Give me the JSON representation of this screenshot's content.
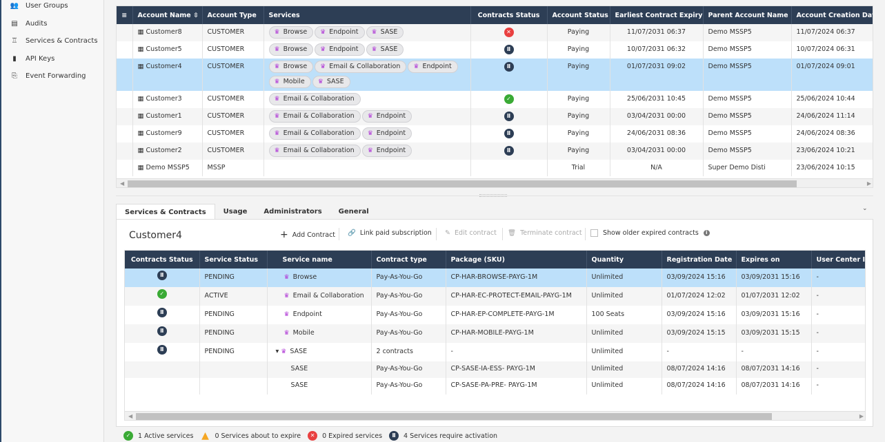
{
  "sidebar": {
    "items": [
      {
        "label": "User Groups",
        "icon": "users-icon",
        "glyph": "👥"
      },
      {
        "label": "Audits",
        "icon": "clipboard-icon",
        "glyph": "▤"
      },
      {
        "label": "Services & Contracts",
        "icon": "award-icon",
        "glyph": "♖"
      },
      {
        "label": "API Keys",
        "icon": "key-box-icon",
        "glyph": "▮"
      },
      {
        "label": "Event Forwarding",
        "icon": "forward-doc-icon",
        "glyph": "⎘"
      }
    ]
  },
  "accounts": {
    "columns": [
      "Account Name",
      "Account Type",
      "Services",
      "Contracts Status",
      "Account Status",
      "Earliest Contract Expiry",
      "Parent Account Name",
      "Account Creation Date"
    ],
    "rows": [
      {
        "name": "Customer8",
        "type": "CUSTOMER",
        "services": [
          "Browse",
          "Endpoint",
          "SASE"
        ],
        "contracts_status": "expired",
        "account_status": "Paying",
        "expiry": "11/07/2031 06:37",
        "parent": "Demo MSSP5",
        "created": "11/07/2024 06:37"
      },
      {
        "name": "Customer5",
        "type": "CUSTOMER",
        "services": [
          "Browse",
          "Endpoint",
          "SASE"
        ],
        "contracts_status": "pending",
        "account_status": "Paying",
        "expiry": "10/07/2031 06:32",
        "parent": "Demo MSSP5",
        "created": "10/07/2024 06:31"
      },
      {
        "name": "Customer4",
        "type": "CUSTOMER",
        "services": [
          "Browse",
          "Email & Collaboration",
          "Endpoint",
          "Mobile",
          "SASE"
        ],
        "contracts_status": "pending",
        "account_status": "Paying",
        "expiry": "01/07/2031 09:02",
        "parent": "Demo MSSP5",
        "created": "01/07/2024 09:01",
        "selected": true
      },
      {
        "name": "Customer3",
        "type": "CUSTOMER",
        "services": [
          "Email & Collaboration"
        ],
        "contracts_status": "active",
        "account_status": "Paying",
        "expiry": "25/06/2031 10:45",
        "parent": "Demo MSSP5",
        "created": "25/06/2024 10:44"
      },
      {
        "name": "Customer1",
        "type": "CUSTOMER",
        "services": [
          "Email & Collaboration",
          "Endpoint"
        ],
        "contracts_status": "pending",
        "account_status": "Paying",
        "expiry": "03/04/2031 00:00",
        "parent": "Demo MSSP5",
        "created": "24/06/2024 11:14"
      },
      {
        "name": "Customer9",
        "type": "CUSTOMER",
        "services": [
          "Email & Collaboration",
          "Endpoint"
        ],
        "contracts_status": "pending",
        "account_status": "Paying",
        "expiry": "24/06/2031 08:36",
        "parent": "Demo MSSP5",
        "created": "24/06/2024 08:36"
      },
      {
        "name": "Customer2",
        "type": "CUSTOMER",
        "services": [
          "Email & Collaboration",
          "Endpoint"
        ],
        "contracts_status": "pending",
        "account_status": "Paying",
        "expiry": "03/04/2031 00:00",
        "parent": "Demo MSSP5",
        "created": "23/06/2024 10:21"
      },
      {
        "name": "Demo MSSP5",
        "type": "MSSP",
        "services": [],
        "contracts_status": "",
        "account_status": "Trial",
        "expiry": "N/A",
        "parent": "Super Demo Disti",
        "created": "23/06/2024 10:15"
      }
    ]
  },
  "tabs": [
    {
      "label": "Services & Contracts",
      "active": true
    },
    {
      "label": "Usage"
    },
    {
      "label": "Administrators"
    },
    {
      "label": "General"
    }
  ],
  "detail": {
    "title": "Customer4",
    "toolbar": {
      "add": "Add Contract",
      "link": "Link paid subscription",
      "edit": "Edit contract",
      "terminate": "Terminate contract",
      "show_expired": "Show older expired contracts",
      "show_expired_checked": false
    },
    "columns": [
      "Contracts Status",
      "Service Status",
      "Service name",
      "Contract type",
      "Package (SKU)",
      "Quantity",
      "Registration Date",
      "Expires on",
      "User Center ID"
    ],
    "rows": [
      {
        "cs": "pending",
        "ss": "PENDING",
        "name": "Browse",
        "ct": "Pay-As-You-Go",
        "sku": "CP-HAR-BROWSE-PAYG-1M",
        "qty": "Unlimited",
        "reg": "03/09/2024 15:16",
        "exp": "03/09/2031 15:16",
        "uc": "-",
        "selected": true
      },
      {
        "cs": "active",
        "ss": "ACTIVE",
        "name": "Email & Collaboration",
        "ct": "Pay-As-You-Go",
        "sku": "CP-HAR-EC-PROTECT-EMAIL-PAYG-1M",
        "qty": "Unlimited",
        "reg": "01/07/2024 12:02",
        "exp": "01/07/2031 12:02",
        "uc": "-"
      },
      {
        "cs": "pending",
        "ss": "PENDING",
        "name": "Endpoint",
        "ct": "Pay-As-You-Go",
        "sku": "CP-HAR-EP-COMPLETE-PAYG-1M",
        "qty": "100 Seats",
        "reg": "03/09/2024 15:16",
        "exp": "03/09/2031 15:16",
        "uc": "-"
      },
      {
        "cs": "pending",
        "ss": "PENDING",
        "name": "Mobile",
        "ct": "Pay-As-You-Go",
        "sku": "CP-HAR-MOBILE-PAYG-1M",
        "qty": "Unlimited",
        "reg": "03/09/2024 15:15",
        "exp": "03/09/2031 15:15",
        "uc": "-"
      },
      {
        "cs": "pending",
        "ss": "PENDING",
        "name": "SASE",
        "ct": "2 contracts",
        "sku": "-",
        "qty": "Unlimited",
        "reg": "-",
        "exp": "-",
        "uc": "-",
        "expanded": true
      },
      {
        "cs": "",
        "ss": "",
        "name": "SASE",
        "ct": "Pay-As-You-Go",
        "sku": "CP-SASE-IA-ESS- PAYG-1M",
        "qty": "Unlimited",
        "reg": "08/07/2024 14:16",
        "exp": "08/07/2031 14:16",
        "uc": "-",
        "child": true
      },
      {
        "cs": "",
        "ss": "",
        "name": "SASE",
        "ct": "Pay-As-You-Go",
        "sku": "CP-SASE-PA-PRE- PAYG-1M",
        "qty": "Unlimited",
        "reg": "08/07/2024 14:16",
        "exp": "08/07/2031 14:16",
        "uc": "-",
        "child": true
      }
    ]
  },
  "legend": [
    {
      "status": "active",
      "text": "1 Active services"
    },
    {
      "status": "warn",
      "text": "0 Services about to expire"
    },
    {
      "status": "expired",
      "text": "0 Expired services"
    },
    {
      "status": "pending",
      "text": "4 Services require activation"
    }
  ],
  "colors": {
    "header": "#2d3e55",
    "selected": "#bde0fa",
    "active": "#3aaa35",
    "expired": "#e94040",
    "warn": "#f5a623",
    "service_icon": "#b03ad6"
  }
}
